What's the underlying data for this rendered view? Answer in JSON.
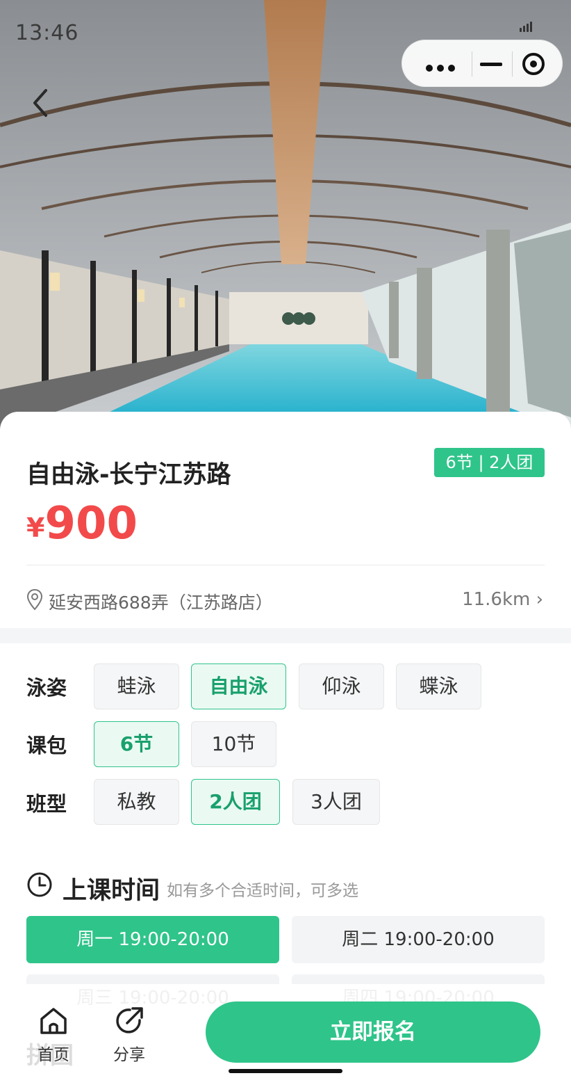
{
  "status_bar": {
    "time": "13:46"
  },
  "hero": {
    "image_description": "indoor swimming pool with curved wooden ceiling"
  },
  "product": {
    "title": "自由泳-长宁江苏路",
    "tag": "6节 | 2人团",
    "price_currency": "¥",
    "price_value": "900",
    "address": "延安西路688弄（江苏路店）",
    "distance": "11.6km ›"
  },
  "options": {
    "stroke": {
      "label": "泳姿",
      "items": [
        "蛙泳",
        "自由泳",
        "仰泳",
        "蝶泳"
      ],
      "selected": "自由泳"
    },
    "package": {
      "label": "课包",
      "items": [
        "6节",
        "10节"
      ],
      "selected": "6节"
    },
    "class_type": {
      "label": "班型",
      "items": [
        "私教",
        "2人团",
        "3人团"
      ],
      "selected": "2人团"
    }
  },
  "schedule": {
    "title": "上课时间",
    "subtitle": "如有多个合适时间，可多选",
    "slots": [
      {
        "label": "周一 19:00-20:00",
        "selected": true
      },
      {
        "label": "周二 19:00-20:00",
        "selected": false
      },
      {
        "label": "周三 19:00-20:00",
        "selected": false
      },
      {
        "label": "周四 19:00-20:00",
        "selected": false
      }
    ]
  },
  "bottom_bar": {
    "home_label": "首页",
    "share_label": "分享",
    "cta_label": "立即报名",
    "hidden_section": "拼团"
  },
  "colors": {
    "accent": "#2fc48a",
    "price": "#f24a4a",
    "tag_bg": "#2fc48a"
  }
}
